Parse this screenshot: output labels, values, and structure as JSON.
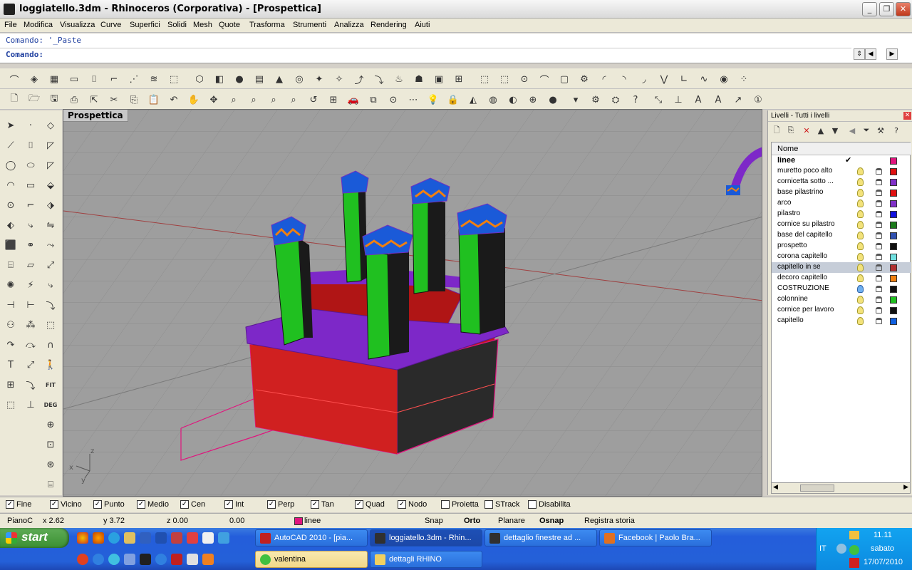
{
  "window": {
    "title": "loggiatello.3dm - Rhinoceros (Corporativa) - [Prospettica]",
    "min": "_",
    "max": "❐",
    "close": "✕"
  },
  "menu": [
    "File",
    "Modifica",
    "Visualizza",
    "Curve",
    "Superfici",
    "Solidi",
    "Mesh",
    "Quote",
    "Trasforma",
    "Strumenti",
    "Analizza",
    "Rendering",
    "Aiuti"
  ],
  "command": {
    "history": "Comando: '_Paste",
    "prompt": "Comando:"
  },
  "viewport": {
    "label": "Prospettica",
    "axis_x": "x",
    "axis_y": "y",
    "axis_z": "z"
  },
  "layers": {
    "panel_title": "Livelli - Tutti i livelli",
    "column_name": "Nome",
    "rows": [
      {
        "name": "linee",
        "current": true,
        "color": "#e0157e"
      },
      {
        "name": "muretto poco alto",
        "color": "#e01010"
      },
      {
        "name": "cornicetta sotto ...",
        "color": "#8030c8"
      },
      {
        "name": "base pilastrino",
        "color": "#e01010"
      },
      {
        "name": "arco",
        "color": "#8030c8"
      },
      {
        "name": "pilastro",
        "color": "#1010e0"
      },
      {
        "name": "cornice su pilastro",
        "color": "#1a7a1a"
      },
      {
        "name": "base del capitello",
        "color": "#3050b0"
      },
      {
        "name": "prospetto",
        "color": "#101010"
      },
      {
        "name": "corona capitello",
        "color": "#70e0e0"
      },
      {
        "name": "capitello in se",
        "color": "#b03030",
        "selected": true
      },
      {
        "name": "decoro capitello",
        "color": "#f08010"
      },
      {
        "name": "COSTRUZIONE",
        "color": "#101010",
        "blue_bulb": true
      },
      {
        "name": "colonnine",
        "color": "#20c020"
      },
      {
        "name": "cornice per lavoro",
        "color": "#101010"
      },
      {
        "name": "capitello",
        "color": "#1060e0"
      }
    ]
  },
  "osnap": [
    {
      "label": "Fine",
      "checked": true
    },
    {
      "label": "Vicino",
      "checked": true
    },
    {
      "label": "Punto",
      "checked": true
    },
    {
      "label": "Medio",
      "checked": true
    },
    {
      "label": "Cen",
      "checked": true
    },
    {
      "label": "Int",
      "checked": true
    },
    {
      "label": "Perp",
      "checked": true
    },
    {
      "label": "Tan",
      "checked": true
    },
    {
      "label": "Quad",
      "checked": true
    },
    {
      "label": "Nodo",
      "checked": true
    },
    {
      "label": "Proietta",
      "checked": false
    },
    {
      "label": "STrack",
      "checked": false
    },
    {
      "label": "Disabilita",
      "checked": false
    }
  ],
  "status": {
    "plane": "PianoC",
    "x": "x 2.62",
    "y": "y 3.72",
    "z": "z 0.00",
    "extra": "0.00",
    "layer": "linee",
    "snap": "Snap",
    "orto": "Orto",
    "planare": "Planare",
    "osnap": "Osnap",
    "history": "Registra storia"
  },
  "taskbar": {
    "start": "start",
    "buttons_row1": [
      {
        "label": "AutoCAD 2010 - [pia...",
        "color": "#c02020"
      },
      {
        "label": "loggiatello.3dm - Rhin...",
        "color": "#303030",
        "active": true
      },
      {
        "label": "dettaglio finestre ad ...",
        "color": "#303030"
      },
      {
        "label": "Facebook | Paolo Bra...",
        "color": "#e07020"
      }
    ],
    "buttons_row2": [
      {
        "label": "valentina",
        "color": "#40c040"
      },
      {
        "label": "dettagli RHINO",
        "color": "#f0d060"
      }
    ],
    "lang": "IT",
    "time": "11.11",
    "day": "sabato",
    "date": "17/07/2010"
  }
}
